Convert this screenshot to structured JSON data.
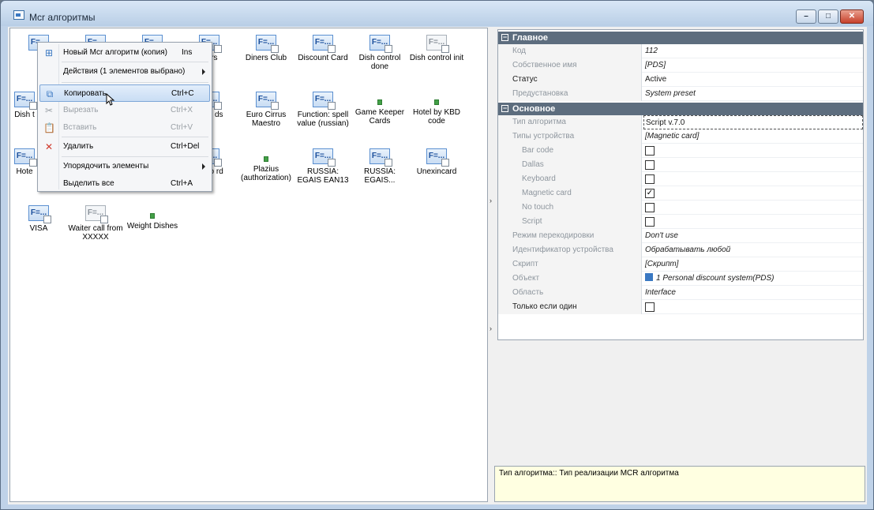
{
  "window": {
    "title": "Mcr алгоритмы",
    "buttons": {
      "minimize": "–",
      "maximize": "□",
      "close": "✕"
    }
  },
  "left_pane": {
    "icons": [
      {
        "label": "",
        "style": "blue"
      },
      {
        "label": "",
        "style": "blue"
      },
      {
        "label": "",
        "style": "blue"
      },
      {
        "label": "ilters",
        "style": "blue"
      },
      {
        "label": "Diners Club",
        "style": "blue"
      },
      {
        "label": "Discount Card",
        "style": "blue"
      },
      {
        "label": "Dish control done",
        "style": "blue"
      },
      {
        "label": "Dish control init",
        "style": "gray"
      },
      {
        "label": "Dish t",
        "style": "blue"
      },
      {
        "label": "ance ds",
        "style": "blue"
      },
      {
        "label": "Euro Cirrus Maestro",
        "style": "blue"
      },
      {
        "label": "Function: spell value (russian)",
        "style": "blue"
      },
      {
        "label": "Game Keeper Cards",
        "style": "green"
      },
      {
        "label": "Hotel by KBD code",
        "style": "green"
      },
      {
        "label": "Hote",
        "style": "blue"
      },
      {
        "label": "/Euro rd",
        "style": "blue"
      },
      {
        "label": "Plazius (authorization)",
        "style": "green"
      },
      {
        "label": "RUSSIA: EGAIS EAN13",
        "style": "blue"
      },
      {
        "label": "RUSSIA: EGAIS...",
        "style": "blue"
      },
      {
        "label": "Unexincard",
        "style": "blue"
      },
      {
        "label": "VISA",
        "style": "blue"
      },
      {
        "label": "Waiter call from XXXXX",
        "style": "gray"
      },
      {
        "label": "Weight Dishes",
        "style": "green"
      }
    ],
    "icon_glyph": "F=..."
  },
  "context_menu": {
    "items": [
      {
        "label": "Новый Mcr алгоритм (копия)",
        "shortcut": "Ins",
        "icon": "new-icon"
      },
      {
        "label": "Действия (1 элементов выбрано)",
        "shortcut": "",
        "icon": ""
      },
      {
        "label": "Копировать",
        "shortcut": "Ctrl+C",
        "icon": "copy-icon"
      },
      {
        "label": "Вырезать",
        "shortcut": "Ctrl+X",
        "icon": "cut-icon"
      },
      {
        "label": "Вставить",
        "shortcut": "Ctrl+V",
        "icon": "paste-icon"
      },
      {
        "label": "Удалить",
        "shortcut": "Ctrl+Del",
        "icon": "delete-icon"
      },
      {
        "label": "Упорядочить элементы",
        "shortcut": "",
        "icon": ""
      },
      {
        "label": "Выделить все",
        "shortcut": "Ctrl+A",
        "icon": ""
      }
    ]
  },
  "property_grid": {
    "category_main": "Главное",
    "category_basic": "Основное",
    "rows": {
      "code": {
        "name": "Код",
        "value": "112"
      },
      "own_name": {
        "name": "Собственное имя",
        "value": "[PDS]"
      },
      "status": {
        "name": "Статус",
        "value": "Active"
      },
      "preset": {
        "name": "Предустановка",
        "value": "System preset"
      },
      "algo_type": {
        "name": "Тип алгоритма",
        "value": "Script v.7.0"
      },
      "device_types": {
        "name": "Типы устройства",
        "value": "[Magnetic card]"
      },
      "bar_code": {
        "name": "Bar code",
        "checked": false
      },
      "dallas": {
        "name": "Dallas",
        "checked": false
      },
      "keyboard": {
        "name": "Keyboard",
        "checked": false
      },
      "magnetic_card": {
        "name": "Magnetic card",
        "checked": true
      },
      "no_touch": {
        "name": "No touch",
        "checked": false
      },
      "script": {
        "name": "Script",
        "checked": false
      },
      "recode_mode": {
        "name": "Режим перекодировки",
        "value": "Don't use"
      },
      "device_id": {
        "name": "Идентификатор устройства",
        "value": "Обрабатывать любой"
      },
      "script_text": {
        "name": "Скрипт",
        "value": "[Скрипт]"
      },
      "object": {
        "name": "Объект",
        "value": "1 Personal discount system(PDS)"
      },
      "area": {
        "name": "Область",
        "value": "Interface"
      },
      "only_if_one": {
        "name": "Только если один",
        "checked": false
      }
    },
    "check_mark": "✓"
  },
  "description": {
    "text": "Тип алгоритма:: Тип реализации MCR алгоритма"
  }
}
